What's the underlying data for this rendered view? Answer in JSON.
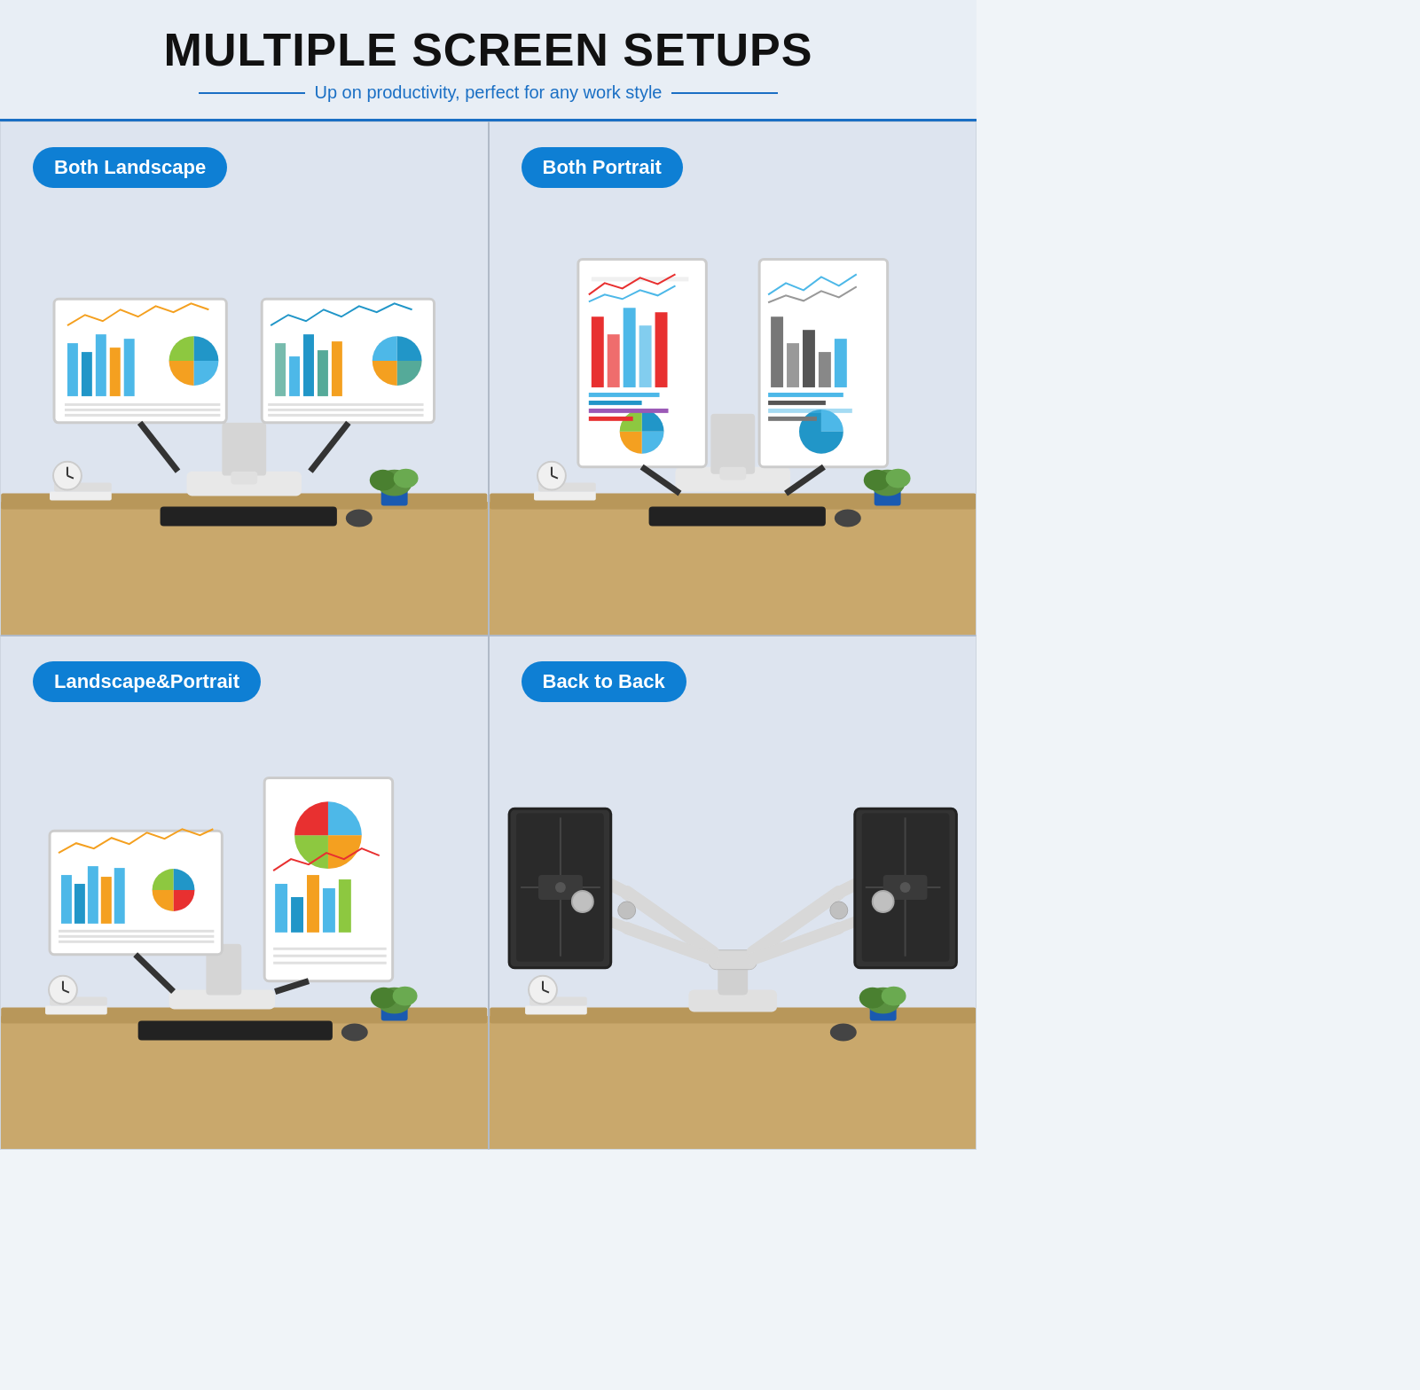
{
  "header": {
    "main_title": "MULTIPLE SCREEN SETUPS",
    "subtitle": "Up on productivity, perfect for any work style",
    "accent_color": "#1a6fc4"
  },
  "cells": [
    {
      "id": "both-landscape",
      "label": "Both Landscape",
      "description": "Two monitors side by side in landscape orientation"
    },
    {
      "id": "both-portrait",
      "label": "Both Portrait",
      "description": "Two monitors side by side in portrait orientation"
    },
    {
      "id": "landscape-portrait",
      "label": "Landscape&Portrait",
      "description": "One landscape and one portrait monitor"
    },
    {
      "id": "back-to-back",
      "label": "Back to Back",
      "description": "Two monitors facing opposite directions"
    }
  ]
}
